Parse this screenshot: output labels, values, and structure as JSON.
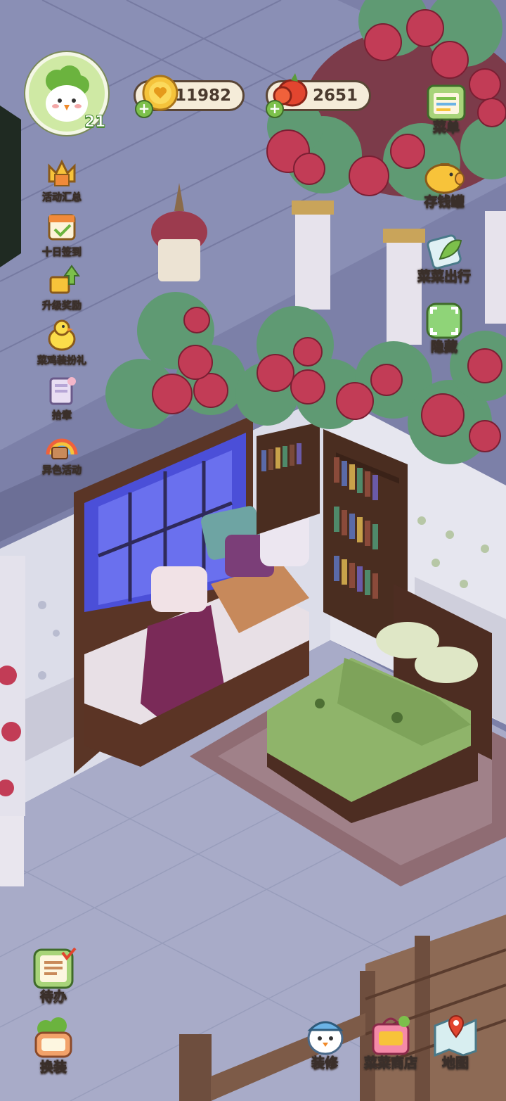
{
  "player": {
    "level": "21"
  },
  "currencies": {
    "coins": "11982",
    "veggies": "2651"
  },
  "left_menu": [
    {
      "label": "活动汇总",
      "icon": "crown-gift-icon"
    },
    {
      "label": "十日签到",
      "icon": "calendar-checkin-icon"
    },
    {
      "label": "升级奖励",
      "icon": "level-up-reward-icon"
    },
    {
      "label": "菜鸡装扮礼",
      "icon": "duck-chick-icon"
    },
    {
      "label": "拾章",
      "icon": "chapter-book-icon"
    },
    {
      "label": "异色活动",
      "icon": "rainbow-event-icon"
    }
  ],
  "right_menu": [
    {
      "label": "菜单",
      "icon": "menu-board-icon"
    },
    {
      "label": "存钱罐",
      "icon": "piggy-bank-icon"
    },
    {
      "label": "菜菜出行",
      "icon": "travel-leaf-icon"
    },
    {
      "label": "隐藏",
      "icon": "hide-frame-icon"
    }
  ],
  "bottom_left": [
    {
      "label": "待办",
      "icon": "todo-list-icon"
    },
    {
      "label": "换装",
      "icon": "dress-up-icon"
    }
  ],
  "bottom_right": [
    {
      "label": "装修",
      "icon": "decorate-icon"
    },
    {
      "label": "菜菜商店",
      "icon": "shop-bag-icon"
    },
    {
      "label": "地图",
      "icon": "map-pin-icon"
    }
  ],
  "colors": {
    "floor": "#8e93b8",
    "wall": "#d9dbe8",
    "rose": "#b8384e",
    "leaf": "#5f9a73",
    "bed_green": "#8fb46a",
    "window_glow": "#5e64e6"
  }
}
